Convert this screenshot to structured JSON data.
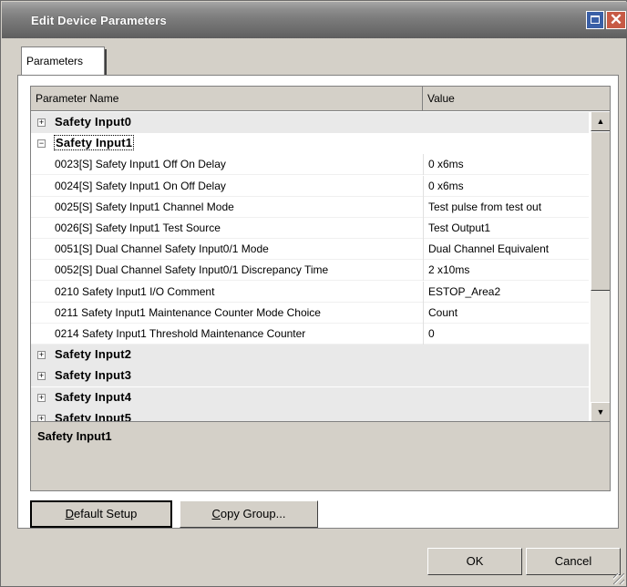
{
  "window": {
    "title": "Edit Device Parameters"
  },
  "tabs": [
    {
      "label": "Parameters"
    }
  ],
  "grid": {
    "columns": [
      "Parameter Name",
      "Value"
    ],
    "rows": [
      {
        "type": "group",
        "label": "Safety Input0",
        "expander": "+"
      },
      {
        "type": "group",
        "label": "Safety Input1",
        "expander": "−"
      },
      {
        "type": "param",
        "name": "0023[S] Safety Input1 Off On Delay",
        "value": "0 x6ms"
      },
      {
        "type": "param",
        "name": "0024[S] Safety Input1 On Off Delay",
        "value": "0 x6ms"
      },
      {
        "type": "param",
        "name": "0025[S] Safety Input1 Channel Mode",
        "value": "Test pulse from test out"
      },
      {
        "type": "param",
        "name": "0026[S] Safety Input1 Test Source",
        "value": "Test Output1"
      },
      {
        "type": "param",
        "name": "0051[S] Dual Channel Safety Input0/1 Mode",
        "value": "Dual Channel Equivalent"
      },
      {
        "type": "param",
        "name": "0052[S] Dual Channel Safety Input0/1 Discrepancy Time",
        "value": "2 x10ms"
      },
      {
        "type": "param",
        "name": "0210 Safety Input1 I/O Comment",
        "value": "ESTOP_Area2"
      },
      {
        "type": "param",
        "name": "0211 Safety Input1 Maintenance Counter Mode Choice",
        "value": "Count"
      },
      {
        "type": "param",
        "name": "0214 Safety Input1 Threshold Maintenance Counter",
        "value": "0"
      },
      {
        "type": "group",
        "label": "Safety Input2",
        "expander": "+"
      },
      {
        "type": "group",
        "label": "Safety Input3",
        "expander": "+"
      },
      {
        "type": "group",
        "label": "Safety Input4",
        "expander": "+"
      },
      {
        "type": "group",
        "label": "Safety Input5",
        "expander": "+"
      }
    ],
    "scroll": {
      "up": "▲",
      "down": "▼"
    }
  },
  "description": {
    "text": "Safety Input1"
  },
  "buttons": {
    "default_setup": {
      "pre": "",
      "mnemonic": "D",
      "post": "efault Setup"
    },
    "copy_group": {
      "pre": "",
      "mnemonic": "C",
      "post": "opy Group..."
    },
    "ok": "OK",
    "cancel": "Cancel"
  },
  "titlebar": {
    "close_glyph": "✕"
  }
}
